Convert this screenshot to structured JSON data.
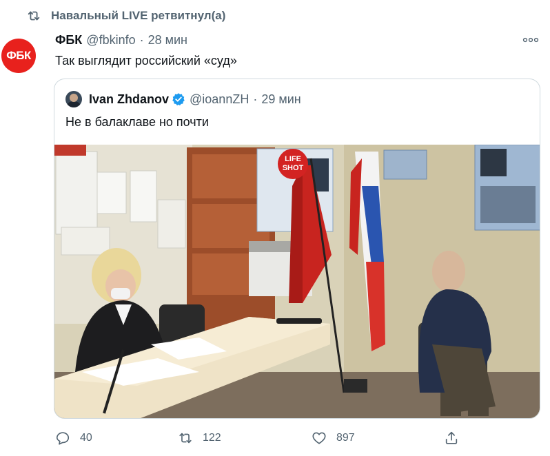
{
  "retweet": {
    "text": "Навальный LIVE ретвитнул(а)"
  },
  "author": {
    "avatar_text": "ФБК",
    "name": "ФБК",
    "handle": "@fbkinfo",
    "separator": "·",
    "time": "28 мин"
  },
  "tweet": {
    "text": "Так выглядит российский «суд»"
  },
  "quoted": {
    "name": "Ivan Zhdanov",
    "handle": "@ioannZH",
    "separator": "·",
    "time": "29 мин",
    "text": "Не в балаклаве но почти",
    "photo_watermark": "LIFE SHOT"
  },
  "actions": {
    "replies": "40",
    "retweets": "122",
    "likes": "897"
  },
  "colors": {
    "brand_red": "#e8211d",
    "secondary_text": "#536471",
    "verified_blue": "#1d9bf0",
    "border": "#cfd9de"
  },
  "icons": [
    "retweet-icon",
    "more-icon",
    "verified-icon",
    "reply-icon",
    "like-icon",
    "share-icon"
  ]
}
